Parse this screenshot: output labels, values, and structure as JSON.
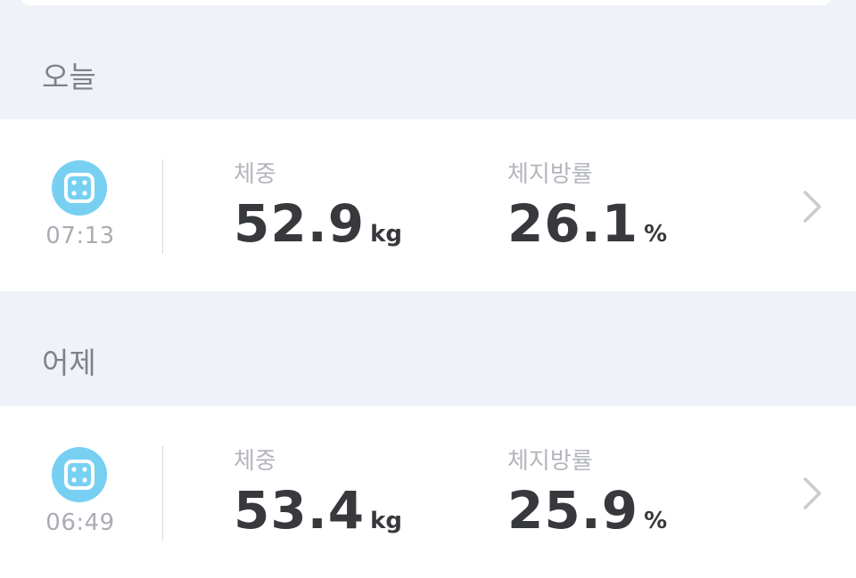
{
  "sections": [
    {
      "header": "오늘",
      "record": {
        "time": "07:13",
        "weight_label": "체중",
        "weight_value": "52.9",
        "weight_unit": "kg",
        "fat_label": "체지방률",
        "fat_value": "26.1",
        "fat_unit": "%",
        "icon": "scale-icon"
      }
    },
    {
      "header": "어제",
      "record": {
        "time": "06:49",
        "weight_label": "체중",
        "weight_value": "53.4",
        "weight_unit": "kg",
        "fat_label": "체지방률",
        "fat_value": "25.9",
        "fat_unit": "%",
        "icon": "scale-icon"
      }
    }
  ],
  "colors": {
    "background": "#eff3f9",
    "icon_accent": "#77d0f2",
    "value_text": "#37393d",
    "label_text": "#b3b6bc",
    "chevron": "#c8cbd0"
  }
}
